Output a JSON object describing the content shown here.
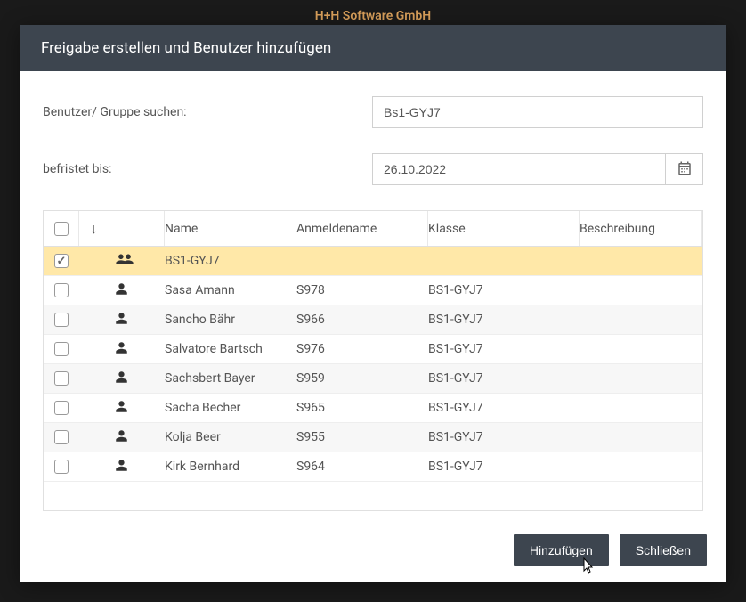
{
  "app_title": "H+H Software GmbH",
  "modal": {
    "title": "Freigabe erstellen und Benutzer hinzufügen",
    "search_label": "Benutzer/ Gruppe suchen:",
    "search_value": "Bs1-GYJ7",
    "date_label": "befristet bis:",
    "date_value": "26.10.2022"
  },
  "table": {
    "headers": {
      "name": "Name",
      "login": "Anmeldename",
      "class": "Klasse",
      "desc": "Beschreibung"
    },
    "rows": [
      {
        "checked": true,
        "type": "group",
        "name": "BS1-GYJ7",
        "login": "",
        "class": "",
        "desc": "",
        "selected": true
      },
      {
        "checked": false,
        "type": "user",
        "name": "Sasa Amann",
        "login": "S978",
        "class": "BS1-GYJ7",
        "desc": ""
      },
      {
        "checked": false,
        "type": "user",
        "name": "Sancho Bähr",
        "login": "S966",
        "class": "BS1-GYJ7",
        "desc": ""
      },
      {
        "checked": false,
        "type": "user",
        "name": "Salvatore Bartsch",
        "login": "S976",
        "class": "BS1-GYJ7",
        "desc": ""
      },
      {
        "checked": false,
        "type": "user",
        "name": "Sachsbert Bayer",
        "login": "S959",
        "class": "BS1-GYJ7",
        "desc": ""
      },
      {
        "checked": false,
        "type": "user",
        "name": "Sacha Becher",
        "login": "S965",
        "class": "BS1-GYJ7",
        "desc": ""
      },
      {
        "checked": false,
        "type": "user",
        "name": "Kolja Beer",
        "login": "S955",
        "class": "BS1-GYJ7",
        "desc": ""
      },
      {
        "checked": false,
        "type": "user",
        "name": "Kirk Bernhard",
        "login": "S964",
        "class": "BS1-GYJ7",
        "desc": ""
      }
    ]
  },
  "footer": {
    "add": "Hinzufügen",
    "close": "Schließen"
  }
}
